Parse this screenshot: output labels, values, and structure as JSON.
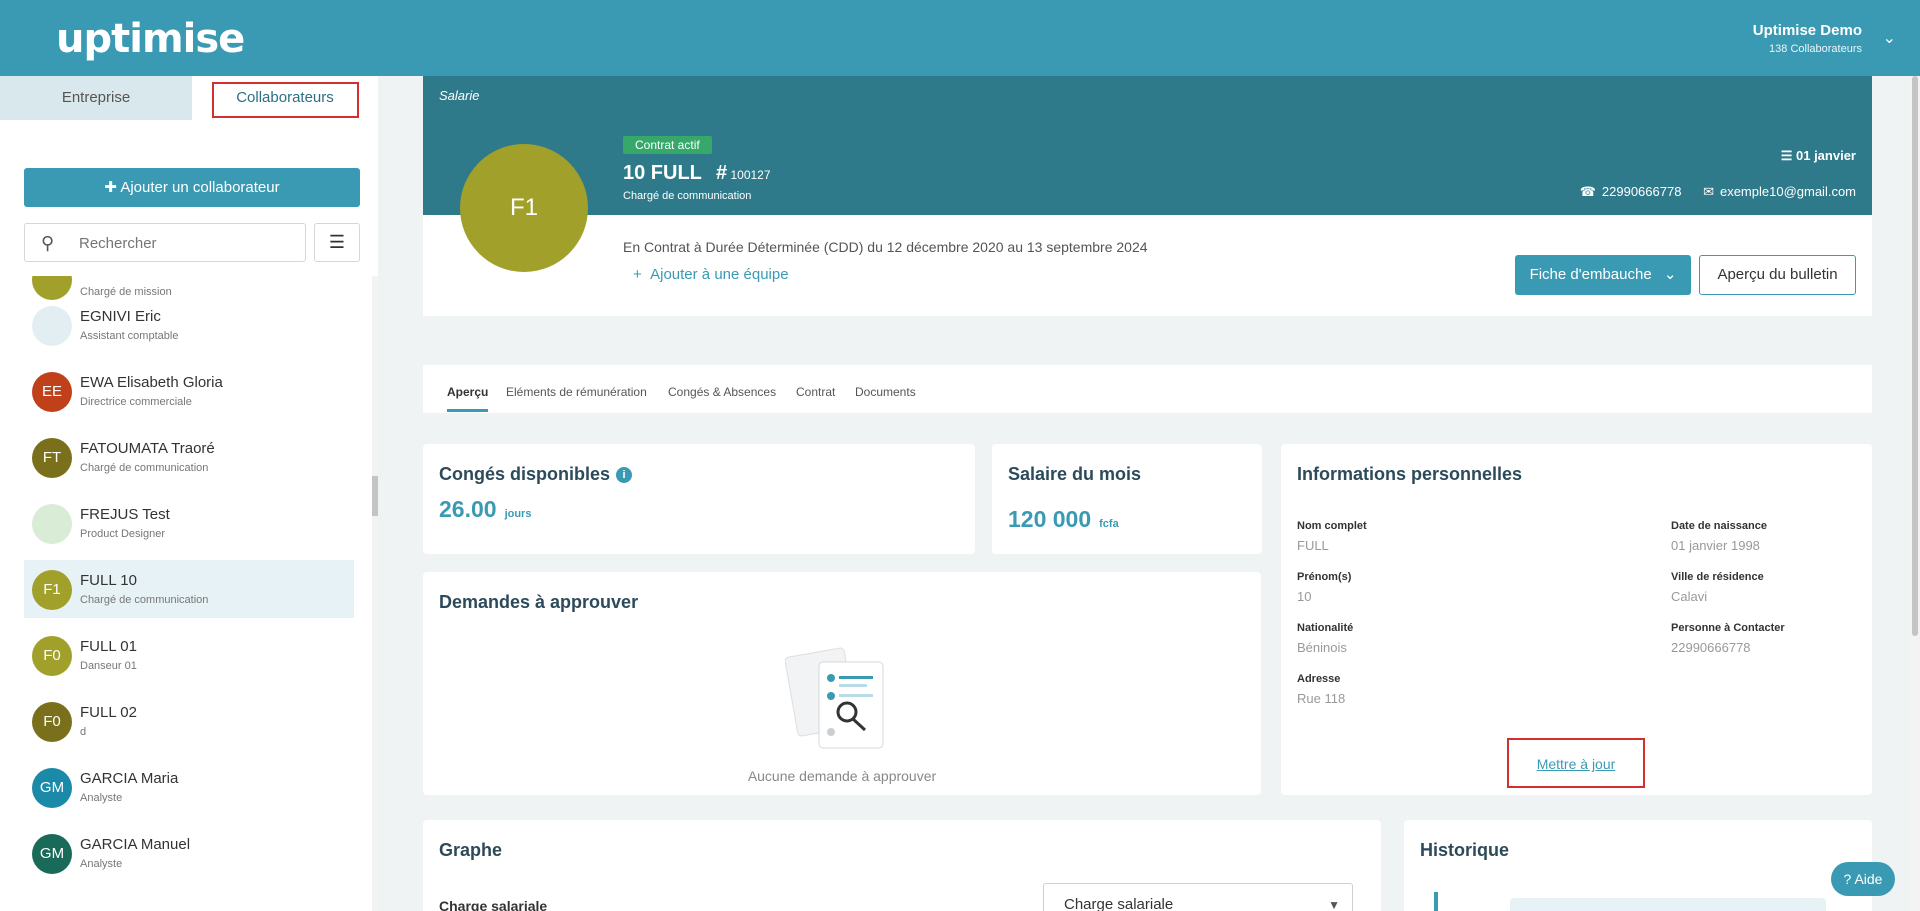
{
  "header": {
    "logo": "uptimise",
    "account_name": "Uptimise Demo",
    "account_sub": "138 Collaborateurs"
  },
  "sidebar": {
    "tab_entreprise": "Entreprise",
    "tab_collaborateurs": "Collaborateurs",
    "add_button": "Ajouter un collaborateur",
    "search_placeholder": "Rechercher",
    "partial_item_job": "Chargé de mission",
    "items": [
      {
        "name": "EGNIVI Eric",
        "job": "Assistant comptable",
        "initials": "",
        "color": "#e3eef2"
      },
      {
        "name": "EWA Elisabeth Gloria",
        "job": "Directrice commerciale",
        "initials": "EE",
        "color": "#c0401a"
      },
      {
        "name": "FATOUMATA Traoré",
        "job": "Chargé de communication",
        "initials": "FT",
        "color": "#7a6f1a"
      },
      {
        "name": "FREJUS Test",
        "job": "Product Designer",
        "initials": "",
        "color": "#d9ecd5"
      },
      {
        "name": "FULL 10",
        "job": "Chargé de communication",
        "initials": "F1",
        "color": "#a0a02a"
      },
      {
        "name": "FULL 01",
        "job": "Danseur 01",
        "initials": "F0",
        "color": "#a0a02a"
      },
      {
        "name": "FULL 02",
        "job": "d",
        "initials": "F0",
        "color": "#7a6f1a"
      },
      {
        "name": "GARCIA Maria",
        "job": "Analyste",
        "initials": "GM",
        "color": "#1a8aa8"
      },
      {
        "name": "GARCIA Manuel",
        "job": "Analyste",
        "initials": "GM",
        "color": "#1a6a5a"
      }
    ]
  },
  "employee": {
    "section_label": "Salarie",
    "initials": "F1",
    "status_badge": "Contrat actif",
    "name": "10 FULL",
    "id": "100127",
    "job": "Chargé de communication",
    "birthday": "01 janvier",
    "phone": "22990666778",
    "email": "exemple10@gmail.com",
    "contract_text": "En Contrat à Durée Déterminée (CDD) du 12 décembre 2020 au 13 septembre 2024",
    "add_team": "Ajouter à une équipe",
    "btn_fiche": "Fiche d'embauche",
    "btn_bulletin": "Aperçu du bulletin"
  },
  "tabs": [
    "Aperçu",
    "Eléments de rémunération",
    "Congés & Absences",
    "Contrat",
    "Documents"
  ],
  "conges": {
    "title": "Congés disponibles",
    "value": "26.00",
    "unit": "jours"
  },
  "salaire": {
    "title": "Salaire du mois",
    "value": "120 000",
    "unit": "fcfa"
  },
  "demandes": {
    "title": "Demandes à approuver",
    "empty": "Aucune demande à approuver"
  },
  "infos": {
    "title": "Informations personnelles",
    "nom_label": "Nom complet",
    "nom": "FULL",
    "prenom_label": "Prénom(s)",
    "prenom": "10",
    "nat_label": "Nationalité",
    "nat": "Béninois",
    "adr_label": "Adresse",
    "adr": "Rue 118",
    "naiss_label": "Date de naissance",
    "naiss": "01 janvier 1998",
    "ville_label": "Ville de résidence",
    "ville": "Calavi",
    "contact_label": "Personne à Contacter",
    "contact": "22990666778",
    "update_link": "Mettre à jour"
  },
  "graphe": {
    "title": "Graphe",
    "sub": "Charge salariale",
    "select_value": "Charge salariale"
  },
  "historique": {
    "title": "Historique"
  },
  "aide": "Aide",
  "colors": {
    "primary": "#3a9ab3",
    "hero": "#2e7a8b",
    "badge": "#36a96a",
    "highlight": "#d32f2f"
  }
}
